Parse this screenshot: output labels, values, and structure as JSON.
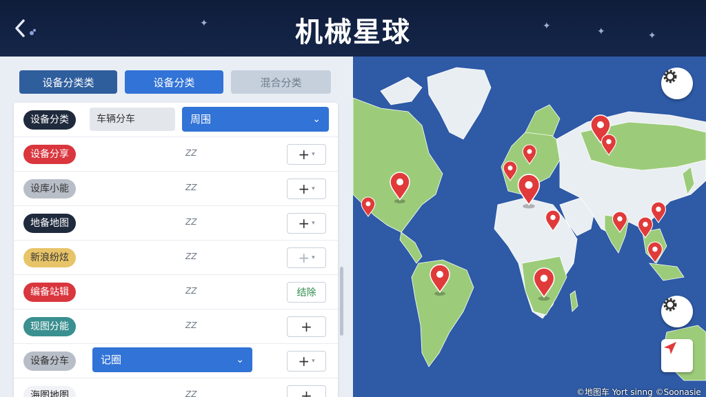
{
  "header": {
    "title": "机械星球"
  },
  "tabs": [
    {
      "label": "设备分类类"
    },
    {
      "label": "设备分类"
    },
    {
      "label": "混合分类"
    }
  ],
  "rows": [
    {
      "chip_label": "设备分类",
      "chip_color": "#1f2a3c",
      "field_text": "车辆分车",
      "select_value": "周围"
    },
    {
      "chip_label": "设备分享",
      "chip_color": "#d9363e",
      "glyph": "ZZ",
      "action": "plus"
    },
    {
      "chip_label": "设库小能",
      "chip_color": "#b8bec7",
      "glyph": "ZZ",
      "action": "plus"
    },
    {
      "chip_label": "地备地图",
      "chip_color": "#1f2a3c",
      "glyph": "ZZ",
      "action": "plus"
    },
    {
      "chip_label": "新浪纷炫",
      "chip_color": "#e8c468",
      "glyph": "ZZ",
      "action": "plus-faded"
    },
    {
      "chip_label": "编备站辑",
      "chip_color": "#d9363e",
      "glyph": "ZZ",
      "action_label": "结除"
    },
    {
      "chip_label": "现图分能",
      "chip_color": "#3a8f8f",
      "glyph": "ZZ",
      "action": "plus"
    },
    {
      "chip_label": "设备分车",
      "chip_color": "#b8bec7",
      "select_value": "记圈",
      "action": "plus"
    },
    {
      "chip_label": "海图地图",
      "glyph": "ZZ",
      "action": "plus"
    }
  ],
  "map": {
    "attribution": "©地图车 Yort sinng ©Soonasie",
    "ocean_color": "#2e5aa6",
    "land_color": "#9ccc7a",
    "pin_color": "#e03a3a"
  }
}
